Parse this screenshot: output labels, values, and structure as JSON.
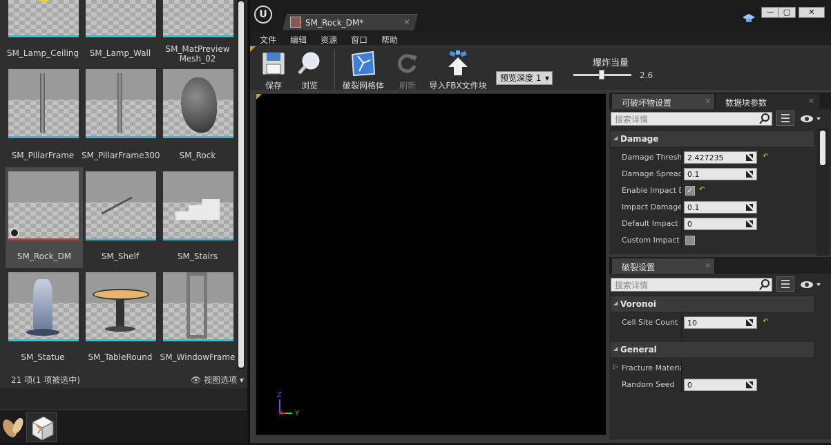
{
  "content_browser": {
    "assets": [
      {
        "name": "SM_Lamp_Ceiling"
      },
      {
        "name": "SM_Lamp_Wall"
      },
      {
        "name": "SM_MatPreview Mesh_02"
      },
      {
        "name": "SM_PillarFrame"
      },
      {
        "name": "SM_PillarFrame300"
      },
      {
        "name": "SM_Rock"
      },
      {
        "name": "SM_Rock_DM",
        "selected": true
      },
      {
        "name": "SM_Shelf"
      },
      {
        "name": "SM_Stairs"
      },
      {
        "name": "SM_Statue"
      },
      {
        "name": "SM_TableRound"
      },
      {
        "name": "SM_WindowFrame"
      }
    ],
    "status_count": "21 项(1 项被选中)",
    "view_options_label": "视图选项"
  },
  "editor": {
    "tab_title": "SM_Rock_DM*",
    "menu": [
      "文件",
      "编辑",
      "资源",
      "窗口",
      "帮助"
    ],
    "toolbar": {
      "save": "保存",
      "browse": "浏览",
      "fracture": "破裂网格体",
      "refresh": "刷新",
      "import_fbx": "导入FBX文件块",
      "preview_depth": "预览深度 1",
      "explode_label": "爆炸当量",
      "explode_value": "2.6"
    },
    "colors": {
      "accent_cyan": "#29c3d6",
      "reset_yellow": "#e8c430"
    }
  },
  "destructible_settings": {
    "tabs": [
      "可破坏物设置",
      "数据块参数"
    ],
    "search_placeholder": "搜索详情",
    "category": "Damage",
    "properties": [
      {
        "name": "Damage Threshold",
        "value": "2.427235",
        "type": "number",
        "reset": true
      },
      {
        "name": "Damage Spread",
        "value": "0.1",
        "type": "number",
        "reset": false
      },
      {
        "name": "Enable Impact Damage",
        "checked": true,
        "type": "bool",
        "reset": true
      },
      {
        "name": "Impact Damage",
        "value": "0.1",
        "type": "number",
        "reset": false
      },
      {
        "name": "Default Impact Damage Depth",
        "value": "0",
        "type": "number",
        "reset": false
      },
      {
        "name": "Custom Impact Resistance",
        "checked": false,
        "type": "bool",
        "reset": false
      }
    ]
  },
  "fracture_settings": {
    "tab": "破裂设置",
    "search_placeholder": "搜索详情",
    "voronoi_category": "Voronoi",
    "cell_site_count_name": "Cell Site Count",
    "cell_site_count_value": "10",
    "general_category": "General",
    "fracture_material_name": "Fracture Material",
    "random_seed_name": "Random Seed",
    "random_seed_value": "0"
  },
  "viewport": {
    "axis_x": "X",
    "axis_y": "Y",
    "axis_z": "Z"
  }
}
